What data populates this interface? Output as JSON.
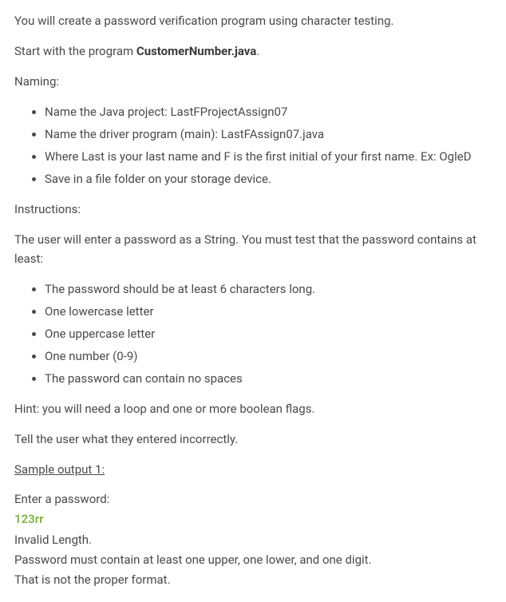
{
  "intro": {
    "line1": "You will create a password verification program using character testing.",
    "line2_prefix": "Start with the program ",
    "line2_bold": "CustomerNumber.java",
    "line2_suffix": "."
  },
  "naming": {
    "heading": "Naming:",
    "items": [
      "Name the Java project: LastFProjectAssign07",
      "Name the driver program (main): LastFAssign07.java",
      "Where Last is your last name and F is the first initial of your first name. Ex: OgleD",
      "Save in a file folder on your storage device."
    ]
  },
  "instructions": {
    "heading": "Instructions:",
    "lead": "The user will enter a password as a String. You must test that the password contains at least:",
    "items": [
      "The password should be at least 6 characters long.",
      "One lowercase letter",
      "One uppercase letter",
      "One number (0-9)",
      "The password can contain no spaces"
    ],
    "hint": "Hint: you will need a loop and one or more boolean flags.",
    "tell": "Tell the user what they entered incorrectly."
  },
  "sample": {
    "heading": "Sample output 1:",
    "prompt": "Enter a password:",
    "user_input": "123rr",
    "output_lines": [
      "Invalid Length.",
      "Password must contain at least one upper, one lower, and one digit.",
      "That is not the proper format."
    ]
  }
}
